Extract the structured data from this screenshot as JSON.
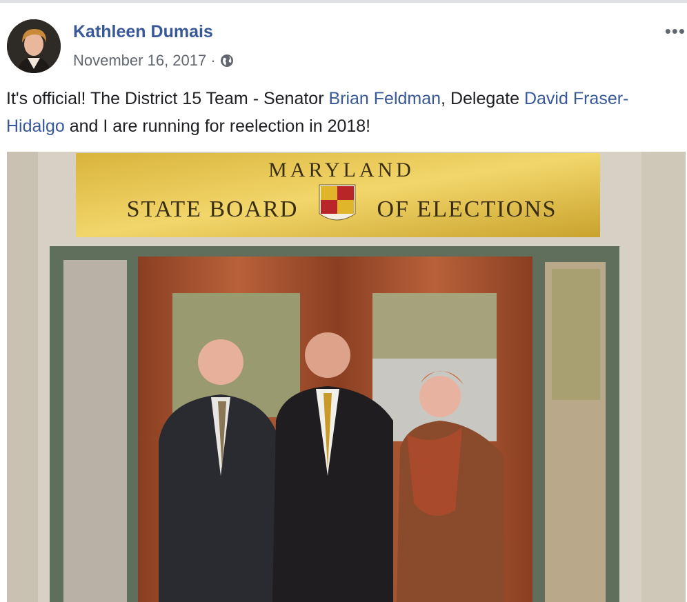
{
  "post": {
    "author": "Kathleen Dumais",
    "date": "November 16, 2017",
    "separator": "·",
    "audience_icon": "globe-icon",
    "more_label": "•••",
    "text_parts": {
      "intro": "It's official! The District 15 Team - Senator ",
      "mention_1": "Brian Feldman",
      "middle": ", Delegate ",
      "mention_2": "David Fraser-Hidalgo",
      "outro": " and I are running for reelection in 2018!"
    }
  },
  "photo": {
    "sign_line_1": "MARYLAND",
    "sign_line_2a": "STATE BOARD",
    "sign_line_2b": "OF ELECTIONS"
  },
  "colors": {
    "link": "#385898",
    "meta": "#606770",
    "text": "#1c1e21"
  }
}
